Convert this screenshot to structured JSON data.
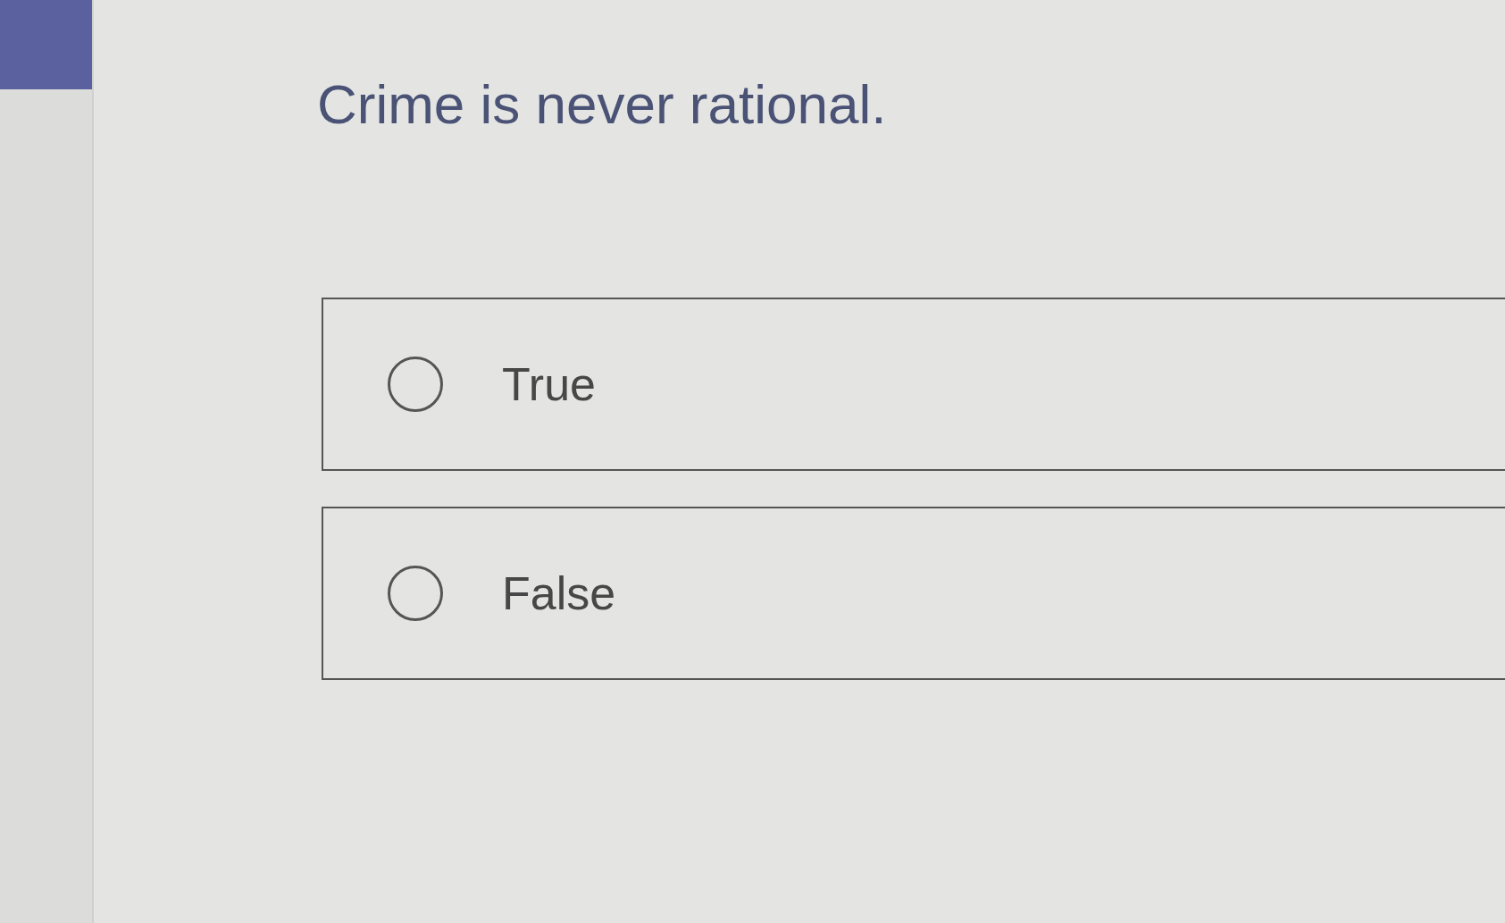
{
  "question": {
    "text": "Crime is never rational."
  },
  "options": [
    {
      "label": "True",
      "selected": false
    },
    {
      "label": "False",
      "selected": false
    }
  ]
}
